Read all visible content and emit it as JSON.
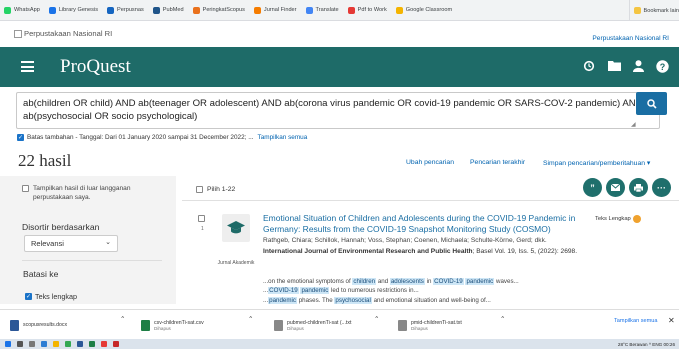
{
  "bookmarks": {
    "items": [
      {
        "label": "WhatsApp",
        "icon": "whatsapp-icon",
        "color": "#25d366"
      },
      {
        "label": "Library Genesis",
        "icon": "person-icon",
        "color": "#1a73e8"
      },
      {
        "label": "Perpusnas",
        "icon": "star-icon",
        "color": "#1565c0"
      },
      {
        "label": "PubMed",
        "icon": "pubmed-icon",
        "color": "#20558a"
      },
      {
        "label": "PeringkatScopus",
        "icon": "scopus-icon",
        "color": "#e9711c"
      },
      {
        "label": "Jurnal Finder",
        "icon": "journal-icon",
        "color": "#f57c00"
      },
      {
        "label": "Translate",
        "icon": "translate-icon",
        "color": "#4285f4"
      },
      {
        "label": "Pdf to Work",
        "icon": "pdf-icon",
        "color": "#e53935"
      },
      {
        "label": "Google Classroom",
        "icon": "classroom-icon",
        "color": "#f4b400"
      }
    ],
    "right_label": "Bookmark lain"
  },
  "banner": {
    "logo_alt": "Perpustakaan Nasional RI",
    "library_link": "Perpustakaan Nasional RI"
  },
  "header": {
    "brand": "ProQuest",
    "color": "#1e6b68"
  },
  "search": {
    "query": "ab(children OR child) AND ab(teenager OR adolescent) AND ab(corona virus pandemic OR covid-19 pandemic OR SARS-COV-2 pandemic) AND ab(psychosocial OR socio psychological)"
  },
  "limits": {
    "text": "Batas tambahan - Tanggal: Dari 01 January 2020 sampai 31 December 2022; ...",
    "show_all": "Tampilkan semua"
  },
  "results_count": "22 hasil",
  "actions": {
    "modify": "Ubah pencarian",
    "recent": "Pencarian terakhir",
    "save": "Simpan pencarian/pemberitahuan ▾"
  },
  "sidebar": {
    "outside_holdings": "Tampilkan hasil di luar langganan perpustakaan saya.",
    "sort_label": "Disortir berdasarkan",
    "sort_value": "Relevansi",
    "limit_label": "Batasi ke",
    "fulltext_label": "Teks lengkap"
  },
  "results_header": {
    "select_range": "Pilih 1-22",
    "tool_icons": [
      "quote-icon",
      "email-icon",
      "print-icon",
      "more-icon"
    ]
  },
  "article": {
    "number": "1",
    "type_label": "Jurnal Akademik",
    "title": "Emotional Situation of Children and Adolescents during the COVID-19 Pandemic in Germany: Results from the COVID-19 Snapshot Monitoring Study (COSMO)",
    "authors": "Rathgeb, Chiara; Schillok, Hannah; Voss, Stephan; Coenen, Michaela; Schulte-Körne, Gerd; dkk.",
    "journal": "International Journal of Environmental Research and Public Health",
    "journal_rest": "; Basel Vol. 19, Iss. 5, (2022): 2698.",
    "fulltext_badge": "Teks Lengkap",
    "snippet": [
      {
        "t": "...on the emotional symptoms of ",
        "h": false
      },
      {
        "t": "children",
        "h": true
      },
      {
        "t": " and ",
        "h": false
      },
      {
        "t": "adolescents",
        "h": true
      },
      {
        "t": " in ",
        "h": false
      },
      {
        "t": "COVID-19",
        "h": true
      },
      {
        "t": " ",
        "h": false
      },
      {
        "t": "pandemic",
        "h": true
      },
      {
        "t": " waves...",
        "h": false
      },
      {
        "t": "\n...",
        "h": false
      },
      {
        "t": "COVID-19",
        "h": true
      },
      {
        "t": " ",
        "h": false
      },
      {
        "t": "pandemic",
        "h": true
      },
      {
        "t": " led to numerous restrictions in...",
        "h": false
      },
      {
        "t": "\n...",
        "h": false
      },
      {
        "t": "pandemic",
        "h": true
      },
      {
        "t": " phases. The ",
        "h": false
      },
      {
        "t": "psychosocial",
        "h": true
      },
      {
        "t": " and emotional situation and well-being of...",
        "h": false
      }
    ]
  },
  "downloads": {
    "items": [
      {
        "name": "scopusresults.docx",
        "sub": "",
        "color": "#2b5797"
      },
      {
        "name": "csv-childrenTi-sat.csv",
        "sub": "Dihapus",
        "color": "#1e7e45"
      },
      {
        "name": "pubmed-childrenTi-sat (...txt",
        "sub": "Dihapus",
        "color": "#888888"
      },
      {
        "name": "pmid-childrenTi-sat.txt",
        "sub": "Dihapus",
        "color": "#888888"
      }
    ],
    "show_all": "Tampilkan semua"
  },
  "taskbar": {
    "tray_text": "28°C Berawan  ^  ENG  00:26"
  }
}
